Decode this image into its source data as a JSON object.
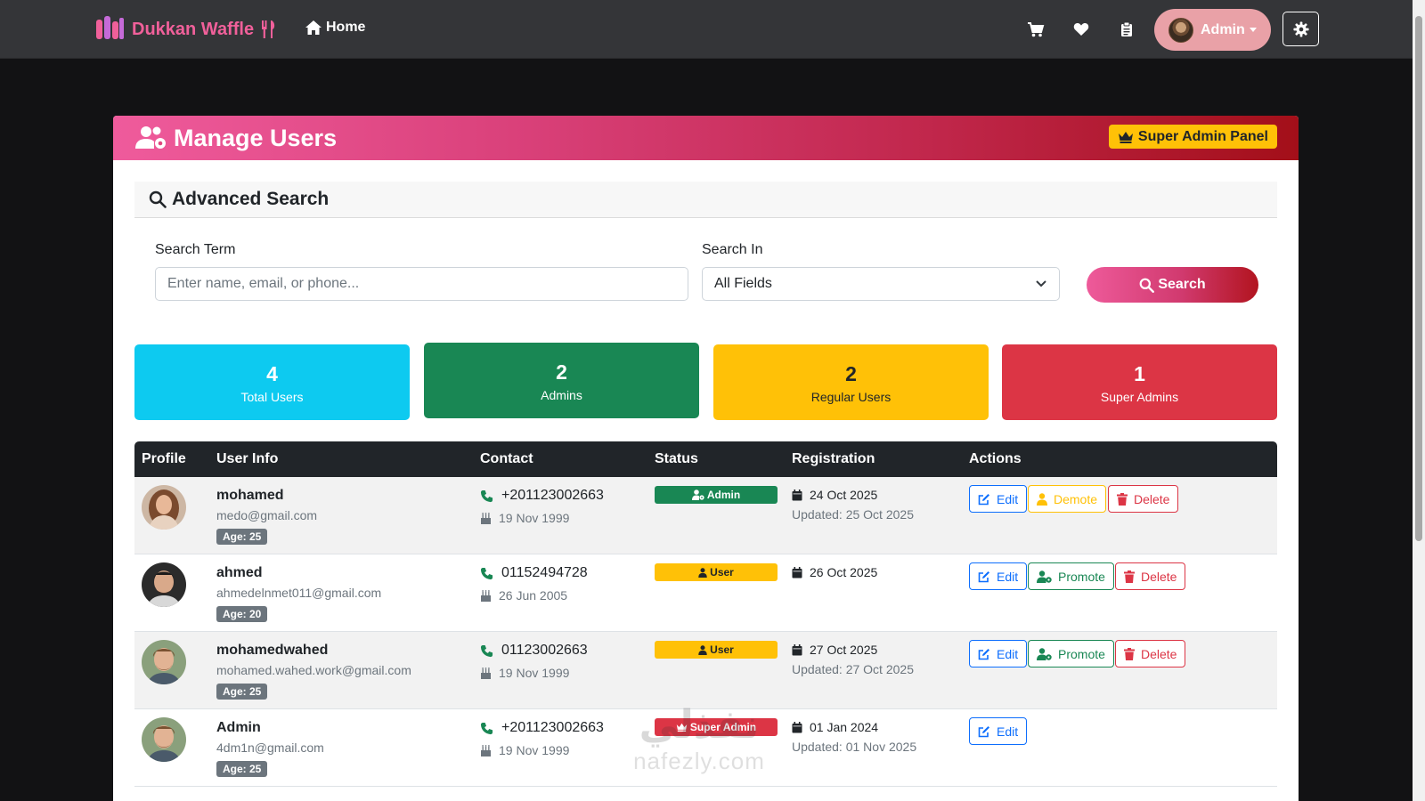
{
  "navbar": {
    "brand": "Dukkan Waffle",
    "home": "Home",
    "user": "Admin",
    "icons": [
      "cart-icon",
      "heart-icon",
      "clipboard-icon",
      "gear-icon"
    ]
  },
  "card": {
    "title": "Manage Users",
    "badge": "Super Admin Panel"
  },
  "search": {
    "heading": "Advanced Search",
    "term_label": "Search Term",
    "term_placeholder": "Enter name, email, or phone...",
    "in_label": "Search In",
    "in_value": "All Fields",
    "button": "Search"
  },
  "stats": [
    {
      "value": "4",
      "label": "Total Users",
      "color": "#0dcaf0"
    },
    {
      "value": "2",
      "label": "Admins",
      "color": "#198754"
    },
    {
      "value": "2",
      "label": "Regular Users",
      "color": "#ffc107"
    },
    {
      "value": "1",
      "label": "Super Admins",
      "color": "#dc3545"
    }
  ],
  "table": {
    "headers": [
      "Profile",
      "User Info",
      "Contact",
      "Status",
      "Registration",
      "Actions"
    ],
    "rows": [
      {
        "name": "mohamed",
        "email": "medo@gmail.com",
        "age": "Age: 25",
        "phone": "+201123002663",
        "birthday": "19 Nov 1999",
        "status": "Admin",
        "registered": "24 Oct 2025",
        "updated": "Updated: 25 Oct 2025",
        "actions": [
          "Edit",
          "Demote",
          "Delete"
        ]
      },
      {
        "name": "ahmed",
        "email": "ahmedelnmet011@gmail.com",
        "age": "Age: 20",
        "phone": "01152494728",
        "birthday": "26 Jun 2005",
        "status": "User",
        "registered": "26 Oct 2025",
        "updated": "",
        "actions": [
          "Edit",
          "Promote",
          "Delete"
        ]
      },
      {
        "name": "mohamedwahed",
        "email": "mohamed.wahed.work@gmail.com",
        "age": "Age: 25",
        "phone": "01123002663",
        "birthday": "19 Nov 1999",
        "status": "User",
        "registered": "27 Oct 2025",
        "updated": "Updated: 27 Oct 2025",
        "actions": [
          "Edit",
          "Promote",
          "Delete"
        ]
      },
      {
        "name": "Admin",
        "email": "4dm1n@gmail.com",
        "age": "Age: 25",
        "phone": "+201123002663",
        "birthday": "19 Nov 1999",
        "status": "Super Admin",
        "registered": "01 Jan 2024",
        "updated": "Updated: 01 Nov 2025",
        "actions": [
          "Edit"
        ]
      }
    ]
  },
  "watermark": {
    "arabic": "نفذلي",
    "latin": "nafezly.com"
  }
}
